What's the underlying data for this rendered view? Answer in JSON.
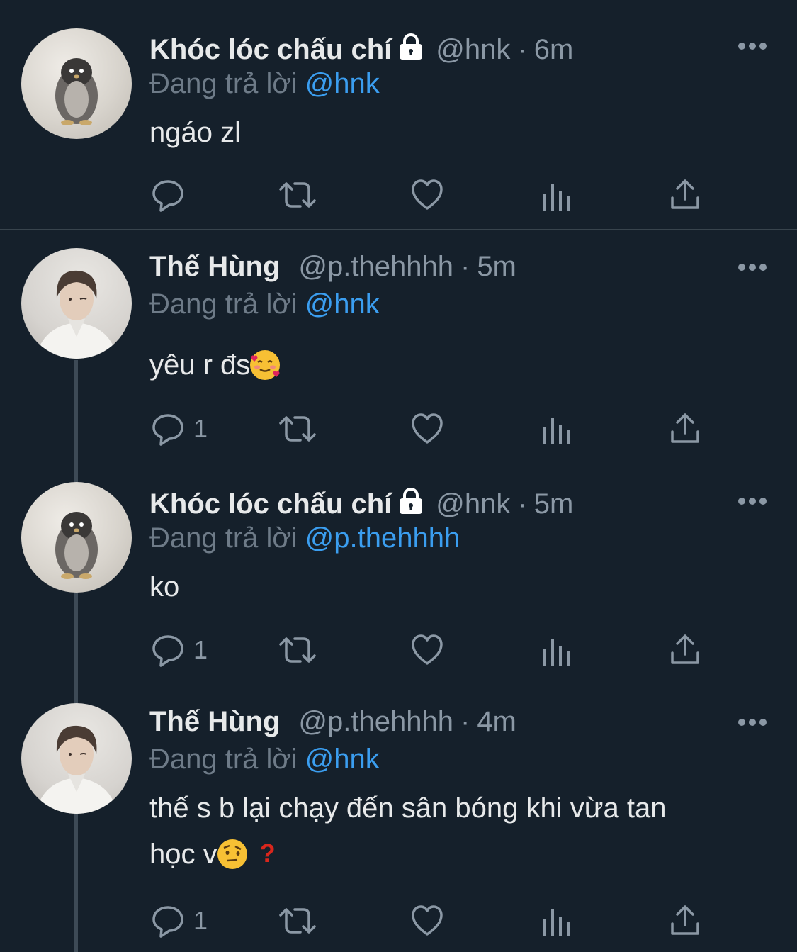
{
  "tweets": [
    {
      "name": "Khóc lóc chấu chí",
      "locked": true,
      "handle": "@hnk",
      "sep": "·",
      "time": "6m",
      "replying_prefix": "Đang trả lời",
      "replying_to": "@hnk",
      "text": "ngáo zl",
      "reply_count": ""
    },
    {
      "name": "Thế Hùng",
      "locked": false,
      "handle": "@p.thehhhh",
      "sep": "·",
      "time": "5m",
      "replying_prefix": "Đang trả lời",
      "replying_to": "@hnk",
      "text": "yêu r đs",
      "emoji": "smiling-face-with-hearts",
      "reply_count": "1"
    },
    {
      "name": "Khóc lóc chấu chí",
      "locked": true,
      "handle": "@hnk",
      "sep": "·",
      "time": "5m",
      "replying_prefix": "Đang trả lời",
      "replying_to": "@p.thehhhh",
      "text": "ko",
      "reply_count": "1"
    },
    {
      "name": "Thế Hùng",
      "locked": false,
      "handle": "@p.thehhhh",
      "sep": "·",
      "time": "4m",
      "replying_prefix": "Đang trả lời",
      "replying_to": "@hnk",
      "text_line1": "thế s b lại chạy đến sân bóng khi vừa tan",
      "text_line2": "học v",
      "emoji": "face-with-raised-eyebrow",
      "emoji2": "red-question-mark",
      "reply_count": "1"
    }
  ],
  "colors": {
    "background": "#15202b",
    "text": "#e7e9ea",
    "secondary": "#8b98a5",
    "mention": "#3b9ef0",
    "divider": "#38444d"
  },
  "icons": [
    "reply-icon",
    "retweet-icon",
    "like-icon",
    "views-icon",
    "share-icon",
    "more-icon",
    "lock-icon"
  ]
}
